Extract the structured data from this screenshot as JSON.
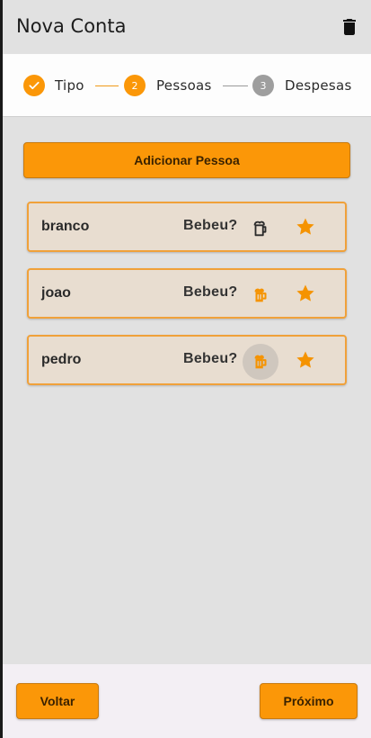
{
  "appbar": {
    "title": "Nova Conta",
    "delete_icon": "trash-icon"
  },
  "stepper": {
    "steps": [
      {
        "number": "",
        "label": "Tipo",
        "state": "done"
      },
      {
        "number": "2",
        "label": "Pessoas",
        "state": "active"
      },
      {
        "number": "3",
        "label": "Despesas",
        "state": "pending"
      }
    ]
  },
  "add_button": {
    "label": "Adicionar Pessoa"
  },
  "people": [
    {
      "name": "branco",
      "drank_label": "Bebeu?",
      "drank": false,
      "mug_icon": "beer-mug-outline-icon",
      "star_icon": "star-icon"
    },
    {
      "name": "joao",
      "drank_label": "Bebeu?",
      "drank": true,
      "mug_icon": "beer-mug-filled-icon",
      "star_icon": "star-icon"
    },
    {
      "name": "pedro",
      "drank_label": "Bebeu?",
      "drank": true,
      "mug_icon": "beer-mug-filled-icon",
      "star_icon": "star-icon"
    }
  ],
  "footer": {
    "back_label": "Voltar",
    "next_label": "Próximo"
  },
  "colors": {
    "accent": "#fb9708",
    "card_bg": "#e8ddd0",
    "card_border": "#f0a13a",
    "step_pending": "#9e9e9e",
    "page_bg": "#e1e1e1"
  }
}
